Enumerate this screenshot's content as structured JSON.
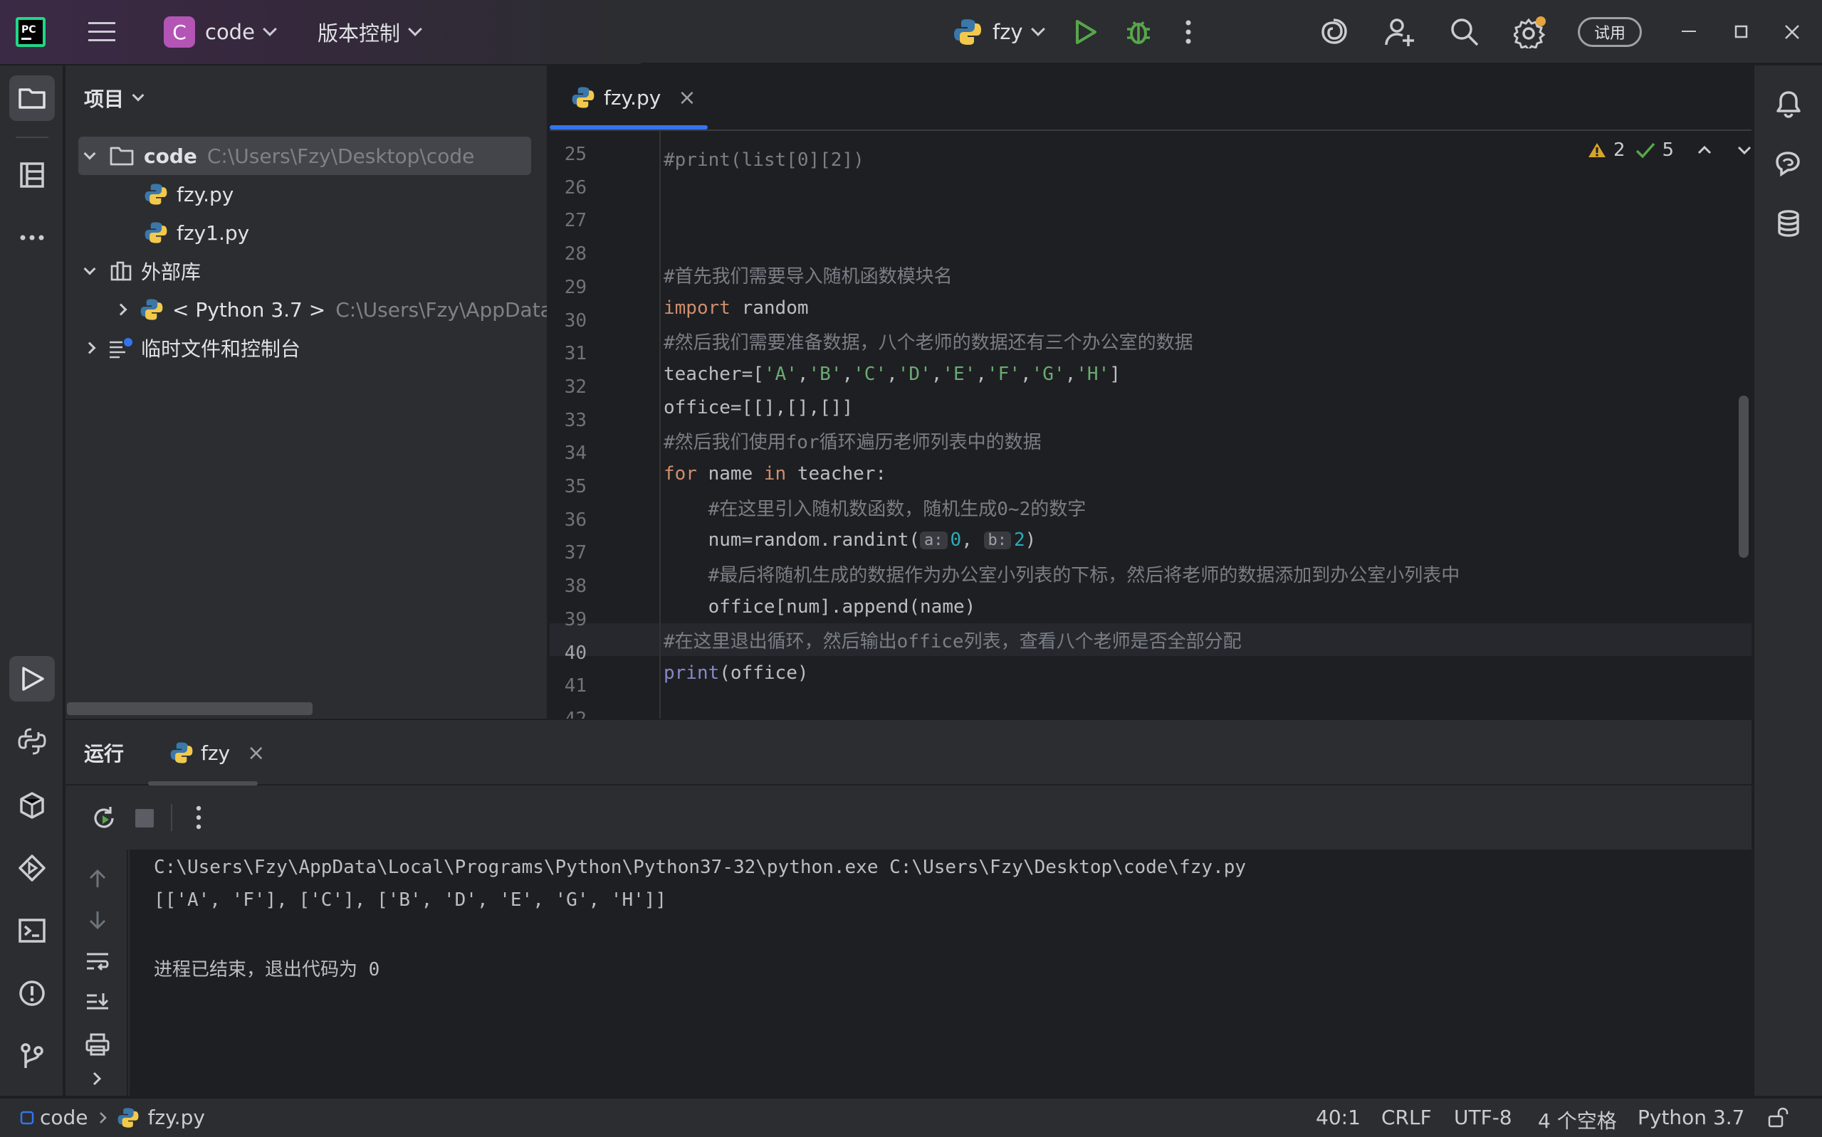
{
  "titlebar": {
    "project_badge": "C",
    "project_name": "code",
    "vcs_menu": "版本控制",
    "run_config": "fzy",
    "trial_label": "试用"
  },
  "project_panel": {
    "title": "项目",
    "root_name": "code",
    "root_path": "C:\\Users\\Fzy\\Desktop\\code",
    "files": [
      "fzy.py",
      "fzy1.py"
    ],
    "external_libs": "外部库",
    "python_sdk": "< Python 3.7 >",
    "python_sdk_path": "C:\\Users\\Fzy\\AppData\\Lc",
    "scratches": "临时文件和控制台"
  },
  "editor": {
    "tab_name": "fzy.py",
    "warnings": "2",
    "checks": "5",
    "line_numbers": [
      "25",
      "26",
      "27",
      "28",
      "29",
      "30",
      "31",
      "32",
      "33",
      "34",
      "35",
      "36",
      "37",
      "38",
      "39",
      "40",
      "41",
      "42"
    ],
    "current_line": "40",
    "code": {
      "l25": "#print(list[0][2])",
      "l27": "#首先我们需要导入随机函数模块名",
      "l28_kw": "import",
      "l28_rest": " random",
      "l29": "#然后我们需要准备数据，八个老师的数据还有三个办公室的数据",
      "l30_pre": "teacher=[",
      "l30_items": [
        "'A'",
        "'B'",
        "'C'",
        "'D'",
        "'E'",
        "'F'",
        "'G'",
        "'H'"
      ],
      "l30_post": "]",
      "l31": "office=[[],[],[]]",
      "l32": "#然后我们使用for循环遍历老师列表中的数据",
      "l33_for": "for",
      "l33_name": " name ",
      "l33_in": "in",
      "l33_rest": " teacher:",
      "l34": "    #在这里引入随机数函数，随机生成0~2的数字",
      "l35_pre": "    num=random.randint(",
      "l35_hint_a": "a:",
      "l35_a": "0",
      "l35_sep": ", ",
      "l35_hint_b": "b:",
      "l35_b": "2",
      "l35_post": ")",
      "l36": "    #最后将随机生成的数据作为办公室小列表的下标，然后将老师的数据添加到办公室小列表中",
      "l37": "    office[num].append(name)",
      "l38": "#在这里退出循环，然后输出office列表，查看八个老师是否全部分配",
      "l39_fn": "print",
      "l39_rest": "(office)"
    }
  },
  "run_panel": {
    "title": "运行",
    "tab_name": "fzy",
    "console_lines": [
      "C:\\Users\\Fzy\\AppData\\Local\\Programs\\Python\\Python37-32\\python.exe C:\\Users\\Fzy\\Desktop\\code\\fzy.py",
      "[['A', 'F'], ['C'], ['B', 'D', 'E', 'G', 'H']]",
      "",
      "进程已结束，退出代码为 0"
    ]
  },
  "statusbar": {
    "breadcrumb_project": "code",
    "breadcrumb_file": "fzy.py",
    "position": "40:1",
    "line_sep": "CRLF",
    "encoding": "UTF-8",
    "indent": "4 个空格",
    "interpreter": "Python 3.7"
  }
}
